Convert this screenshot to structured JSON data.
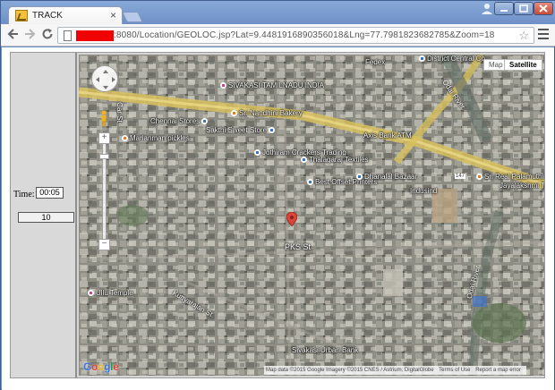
{
  "browser": {
    "tab_title": "TRACK",
    "tab_close": "×",
    "url_suffix": ":8080/Location/GEOLOC.jsp?Lat=9.4481916890356018&Lng=77.7981823682785&Zoom=18"
  },
  "panel": {
    "time_label": "Time:",
    "time_value": "00:05",
    "counter_value": "10"
  },
  "map": {
    "type_buttons": {
      "map": "Map",
      "satellite": "Satellite"
    },
    "pois": [
      {
        "label": "SIVAKASI TAMILNADU INDIA",
        "kind": "pin"
      },
      {
        "label": "Sri Nandhini Bakery",
        "kind": "food"
      },
      {
        "label": "Chennai Stores",
        "kind": "shop"
      },
      {
        "label": "Sakthi Sweet Store",
        "kind": "shop"
      },
      {
        "label": "Marianman pickles",
        "kind": "food"
      },
      {
        "label": "Jothiram Crackers Trading",
        "kind": "shop"
      },
      {
        "label": "Thalagaraj Textiles",
        "kind": "shop"
      },
      {
        "label": "Axis Bank ATM",
        "kind": "shop"
      },
      {
        "label": "Best Offset Printers",
        "kind": "shop"
      },
      {
        "label": "Dhanalal Bazaar",
        "kind": "shop"
      },
      {
        "label": "Indusind",
        "kind": "shop"
      },
      {
        "label": "Sri Real Palamuthir Solai",
        "kind": "food"
      },
      {
        "label": "Jayalakshmi T...",
        "kind": "pin"
      },
      {
        "label": "Fedex",
        "kind": "shop"
      },
      {
        "label": "District Central Co...",
        "kind": "shop"
      },
      {
        "label": "Ullu Temple",
        "kind": "pin"
      },
      {
        "label": "Sivakasi Urban Bank",
        "kind": "shop"
      }
    ],
    "roads": [
      {
        "label": "Odai River"
      },
      {
        "label": "Odai River"
      },
      {
        "label": "PKS St"
      },
      {
        "label": "Kuttyarajan St"
      },
      {
        "label": "147"
      },
      {
        "label": "Car St"
      }
    ],
    "logo": "Google",
    "attribution": {
      "map_data": "Map data ©2015 Google Imagery ©2015 CNES / Astrium, DigitalGlobe",
      "terms": "Terms of Use",
      "report": "Report a map error"
    }
  },
  "colors": {
    "accent": "#6e90c6",
    "marker": "#d9453a",
    "redaction": "#f10000"
  }
}
